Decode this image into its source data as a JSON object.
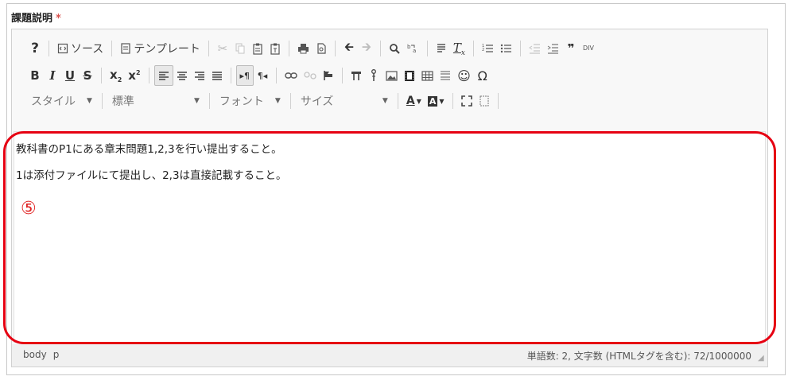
{
  "field": {
    "label": "課題説明",
    "required_mark": "*"
  },
  "toolbar": {
    "row1": {
      "source_label": "ソース",
      "template_label": "テンプレート",
      "blockquote_glyph": "❞",
      "div_glyph": "DIV"
    },
    "row3": {
      "style": "スタイル",
      "format": "標準",
      "font": "フォント",
      "size": "サイズ"
    }
  },
  "content": {
    "paragraphs": [
      "教科書のP1にある章末問題1,2,3を行い提出すること。",
      "1は添付ファイルにて提出し、2,3は直接記載すること。"
    ]
  },
  "annotation": {
    "marker": "⑤",
    "color": "#e60012"
  },
  "status": {
    "path": [
      "body",
      "p"
    ],
    "word_count": "単語数: 2, 文字数 (HTMLタグを含む): 72/1000000"
  }
}
